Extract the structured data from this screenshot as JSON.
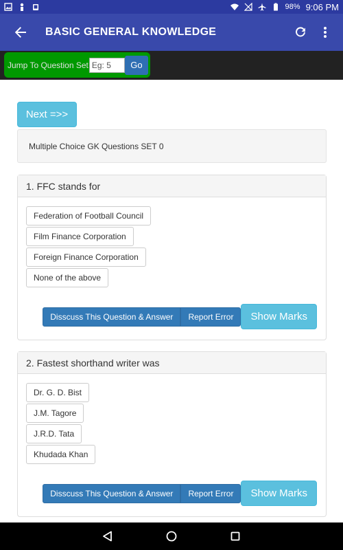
{
  "status_bar": {
    "battery": "98%",
    "time": "9:06 PM"
  },
  "app_bar": {
    "title": "BASIC GENERAL KNOWLEDGE"
  },
  "jump": {
    "label": "Jump To Question Set",
    "placeholder": "Eg: 5",
    "go_label": "Go"
  },
  "next_label": "Next =>>",
  "set_title": "Multiple Choice GK Questions SET 0",
  "questions": [
    {
      "text": "1. FFC stands for",
      "options": [
        "Federation of Football Council",
        "Film Finance Corporation",
        "Foreign Finance Corporation",
        "None of the above"
      ],
      "discuss_label": "Disscuss This Question & Answer",
      "report_label": "Report Error",
      "marks_label": "Show Marks"
    },
    {
      "text": "2. Fastest shorthand writer was",
      "options": [
        "Dr. G. D. Bist",
        "J.M. Tagore",
        "J.R.D. Tata",
        "Khudada Khan"
      ],
      "discuss_label": "Disscuss This Question & Answer",
      "report_label": "Report Error",
      "marks_label": "Show Marks"
    }
  ],
  "icons": {
    "back": "arrow-left-icon",
    "refresh": "refresh-icon",
    "more": "more-vert-icon",
    "nav_back": "nav-back-icon",
    "nav_home": "nav-home-icon",
    "nav_recents": "nav-recents-icon"
  },
  "colors": {
    "app_bar": "#3949ab",
    "status_bar": "#2c3aa0",
    "jump_box": "#009900",
    "primary_btn": "#337ab7",
    "info_btn": "#5bc0de"
  }
}
